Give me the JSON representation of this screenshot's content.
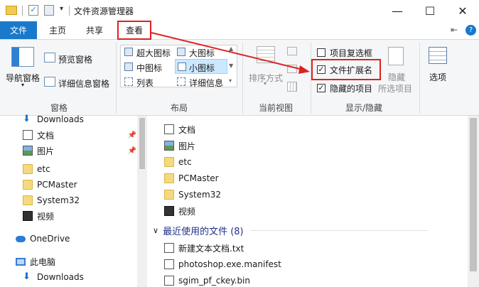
{
  "window": {
    "title": "文件资源管理器",
    "controls": {
      "minimize": "—",
      "maximize": "☐",
      "close": "✕"
    },
    "help": "?",
    "pin": "⇤"
  },
  "tabs": {
    "file": "文件",
    "home": "主页",
    "share": "共享",
    "view": "查看"
  },
  "ribbon": {
    "pane": {
      "nav_pane": "导航窗格",
      "preview_pane": "预览窗格",
      "details_pane": "详细信息窗格",
      "label": "窗格"
    },
    "layout": {
      "extra_large": "超大图标",
      "large": "大图标",
      "medium": "中图标",
      "small": "小图标",
      "list": "列表",
      "details": "详细信息",
      "label": "布局"
    },
    "current_view": {
      "sort_by": "排序方式",
      "label": "当前视图"
    },
    "show_hide": {
      "item_checkboxes": {
        "label": "项目复选框",
        "checked": false
      },
      "file_extensions": {
        "label": "文件扩展名",
        "checked": true
      },
      "hidden_items": {
        "label": "隐藏的项目",
        "checked": true
      },
      "hide_selected": "隐藏\n所选项目",
      "hide_label": "隐藏",
      "selected_label": "所选项目",
      "label": "显示/隐藏"
    },
    "options": {
      "label": "选项"
    }
  },
  "nav": {
    "items": [
      {
        "label": "Downloads",
        "icon": "download-icon"
      },
      {
        "label": "文档",
        "icon": "document-icon",
        "pinned": true
      },
      {
        "label": "图片",
        "icon": "picture-icon",
        "pinned": true
      },
      {
        "label": "etc",
        "icon": "folder-icon"
      },
      {
        "label": "PCMaster",
        "icon": "folder-icon"
      },
      {
        "label": "System32",
        "icon": "folder-icon"
      },
      {
        "label": "视频",
        "icon": "video-icon"
      },
      {
        "label": "OneDrive",
        "icon": "cloud-icon"
      },
      {
        "label": "此电脑",
        "icon": "computer-icon"
      },
      {
        "label": "Downloads",
        "icon": "download-icon"
      }
    ]
  },
  "content": {
    "items": [
      {
        "label": "文档",
        "icon": "document-icon"
      },
      {
        "label": "图片",
        "icon": "picture-icon"
      },
      {
        "label": "etc",
        "icon": "folder-icon"
      },
      {
        "label": "PCMaster",
        "icon": "folder-icon"
      },
      {
        "label": "System32",
        "icon": "folder-icon"
      },
      {
        "label": "视频",
        "icon": "video-icon"
      }
    ],
    "recent_group": "最近使用的文件 (8)",
    "recent_items": [
      {
        "label": "新建文本文档.txt"
      },
      {
        "label": "photoshop.exe.manifest"
      },
      {
        "label": "sgim_pf_ckey.bin"
      }
    ]
  },
  "colors": {
    "file_tab": "#1979ca",
    "highlight": "#e02020",
    "selected": "#cce8ff"
  }
}
